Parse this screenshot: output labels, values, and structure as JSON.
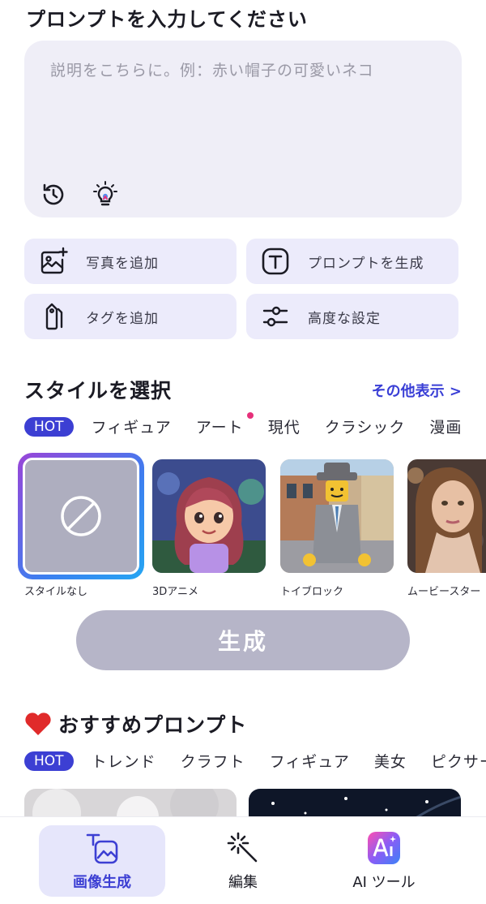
{
  "prompt": {
    "title": "プロンプトを入力してください",
    "placeholder": "説明をこちらに。例：赤い帽子の可愛いネコ",
    "tools": [
      "history-icon",
      "lightbulb-icon"
    ]
  },
  "actions": {
    "add_photo": "写真を追加",
    "generate_prompt": "プロンプトを生成",
    "add_tag": "タグを追加",
    "advanced": "高度な設定"
  },
  "style": {
    "title": "スタイルを選択",
    "more": "その他表示 >",
    "tabs": [
      "HOT",
      "フィギュア",
      "アート",
      "現代",
      "クラシック",
      "漫画"
    ],
    "items": [
      "スタイルなし",
      "3Dアニメ",
      "トイブロック",
      "ムービースター"
    ]
  },
  "generate_label": "生成",
  "recommend": {
    "title": "おすすめプロンプト",
    "tabs": [
      "HOT",
      "トレンド",
      "クラフト",
      "フィギュア",
      "美女",
      "ピクサー"
    ]
  },
  "nav": {
    "items": [
      "画像生成",
      "編集",
      "AI ツール"
    ]
  },
  "colors": {
    "accent": "#3c3fd3",
    "chip_bg": "#ecebfb",
    "generate_disabled": "#b6b5c8",
    "notification_dot": "#e6307a"
  }
}
